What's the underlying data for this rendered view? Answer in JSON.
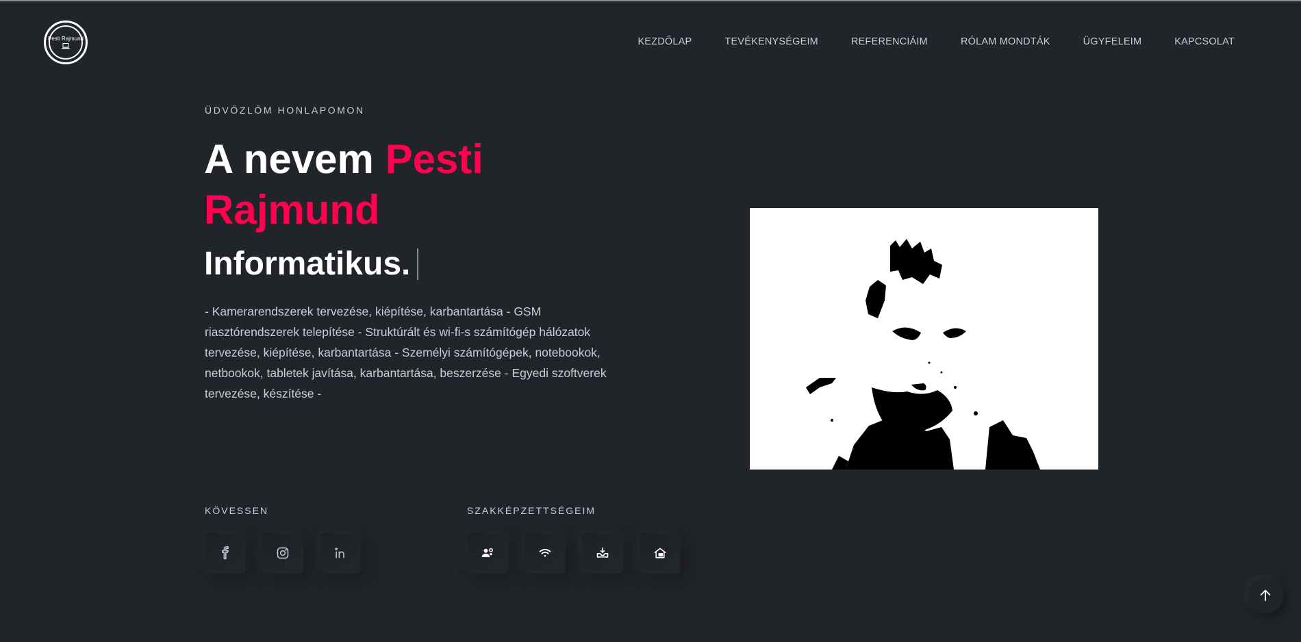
{
  "header": {
    "logo_text": "Pesti Rajmund",
    "nav": [
      {
        "label": "KEZDŐLAP"
      },
      {
        "label": "TEVÉKENYSÉGEIM"
      },
      {
        "label": "REFERENCIÁIM"
      },
      {
        "label": "RÓLAM MONDTÁK"
      },
      {
        "label": "ÜGYFELEIM"
      },
      {
        "label": "KAPCSOLAT"
      }
    ]
  },
  "hero": {
    "welcome": "ÜDVÖZLÖM HONLAPOMON",
    "title_prefix": "A nevem ",
    "title_name": "Pesti Rajmund",
    "role": "Informatikus.",
    "description": "- Kamerarendszerek tervezése, kiépítése, karbantartása - GSM riasztórendszerek telepítése - Struktúrált és wi-fi-s számítógép hálózatok tervezése, kiépítése, karbantartása - Személyi számítógépek, notebookok, netbookok, tabletek javítása, karbantartása, beszerzése - Egyedi szoftverek tervezése, készítése -"
  },
  "follow": {
    "title": "KÖVESSEN",
    "icons": [
      "facebook-icon",
      "instagram-icon",
      "linkedin-icon"
    ]
  },
  "skills": {
    "title": "SZAKKÉPZETTSÉGEIM",
    "icons": [
      "users-gear-icon",
      "wifi-icon",
      "inbox-download-icon",
      "smart-home-icon"
    ]
  },
  "colors": {
    "background": "#212428",
    "accent": "#ff014f",
    "text": "#c4cfde",
    "heading": "#ffffff"
  }
}
